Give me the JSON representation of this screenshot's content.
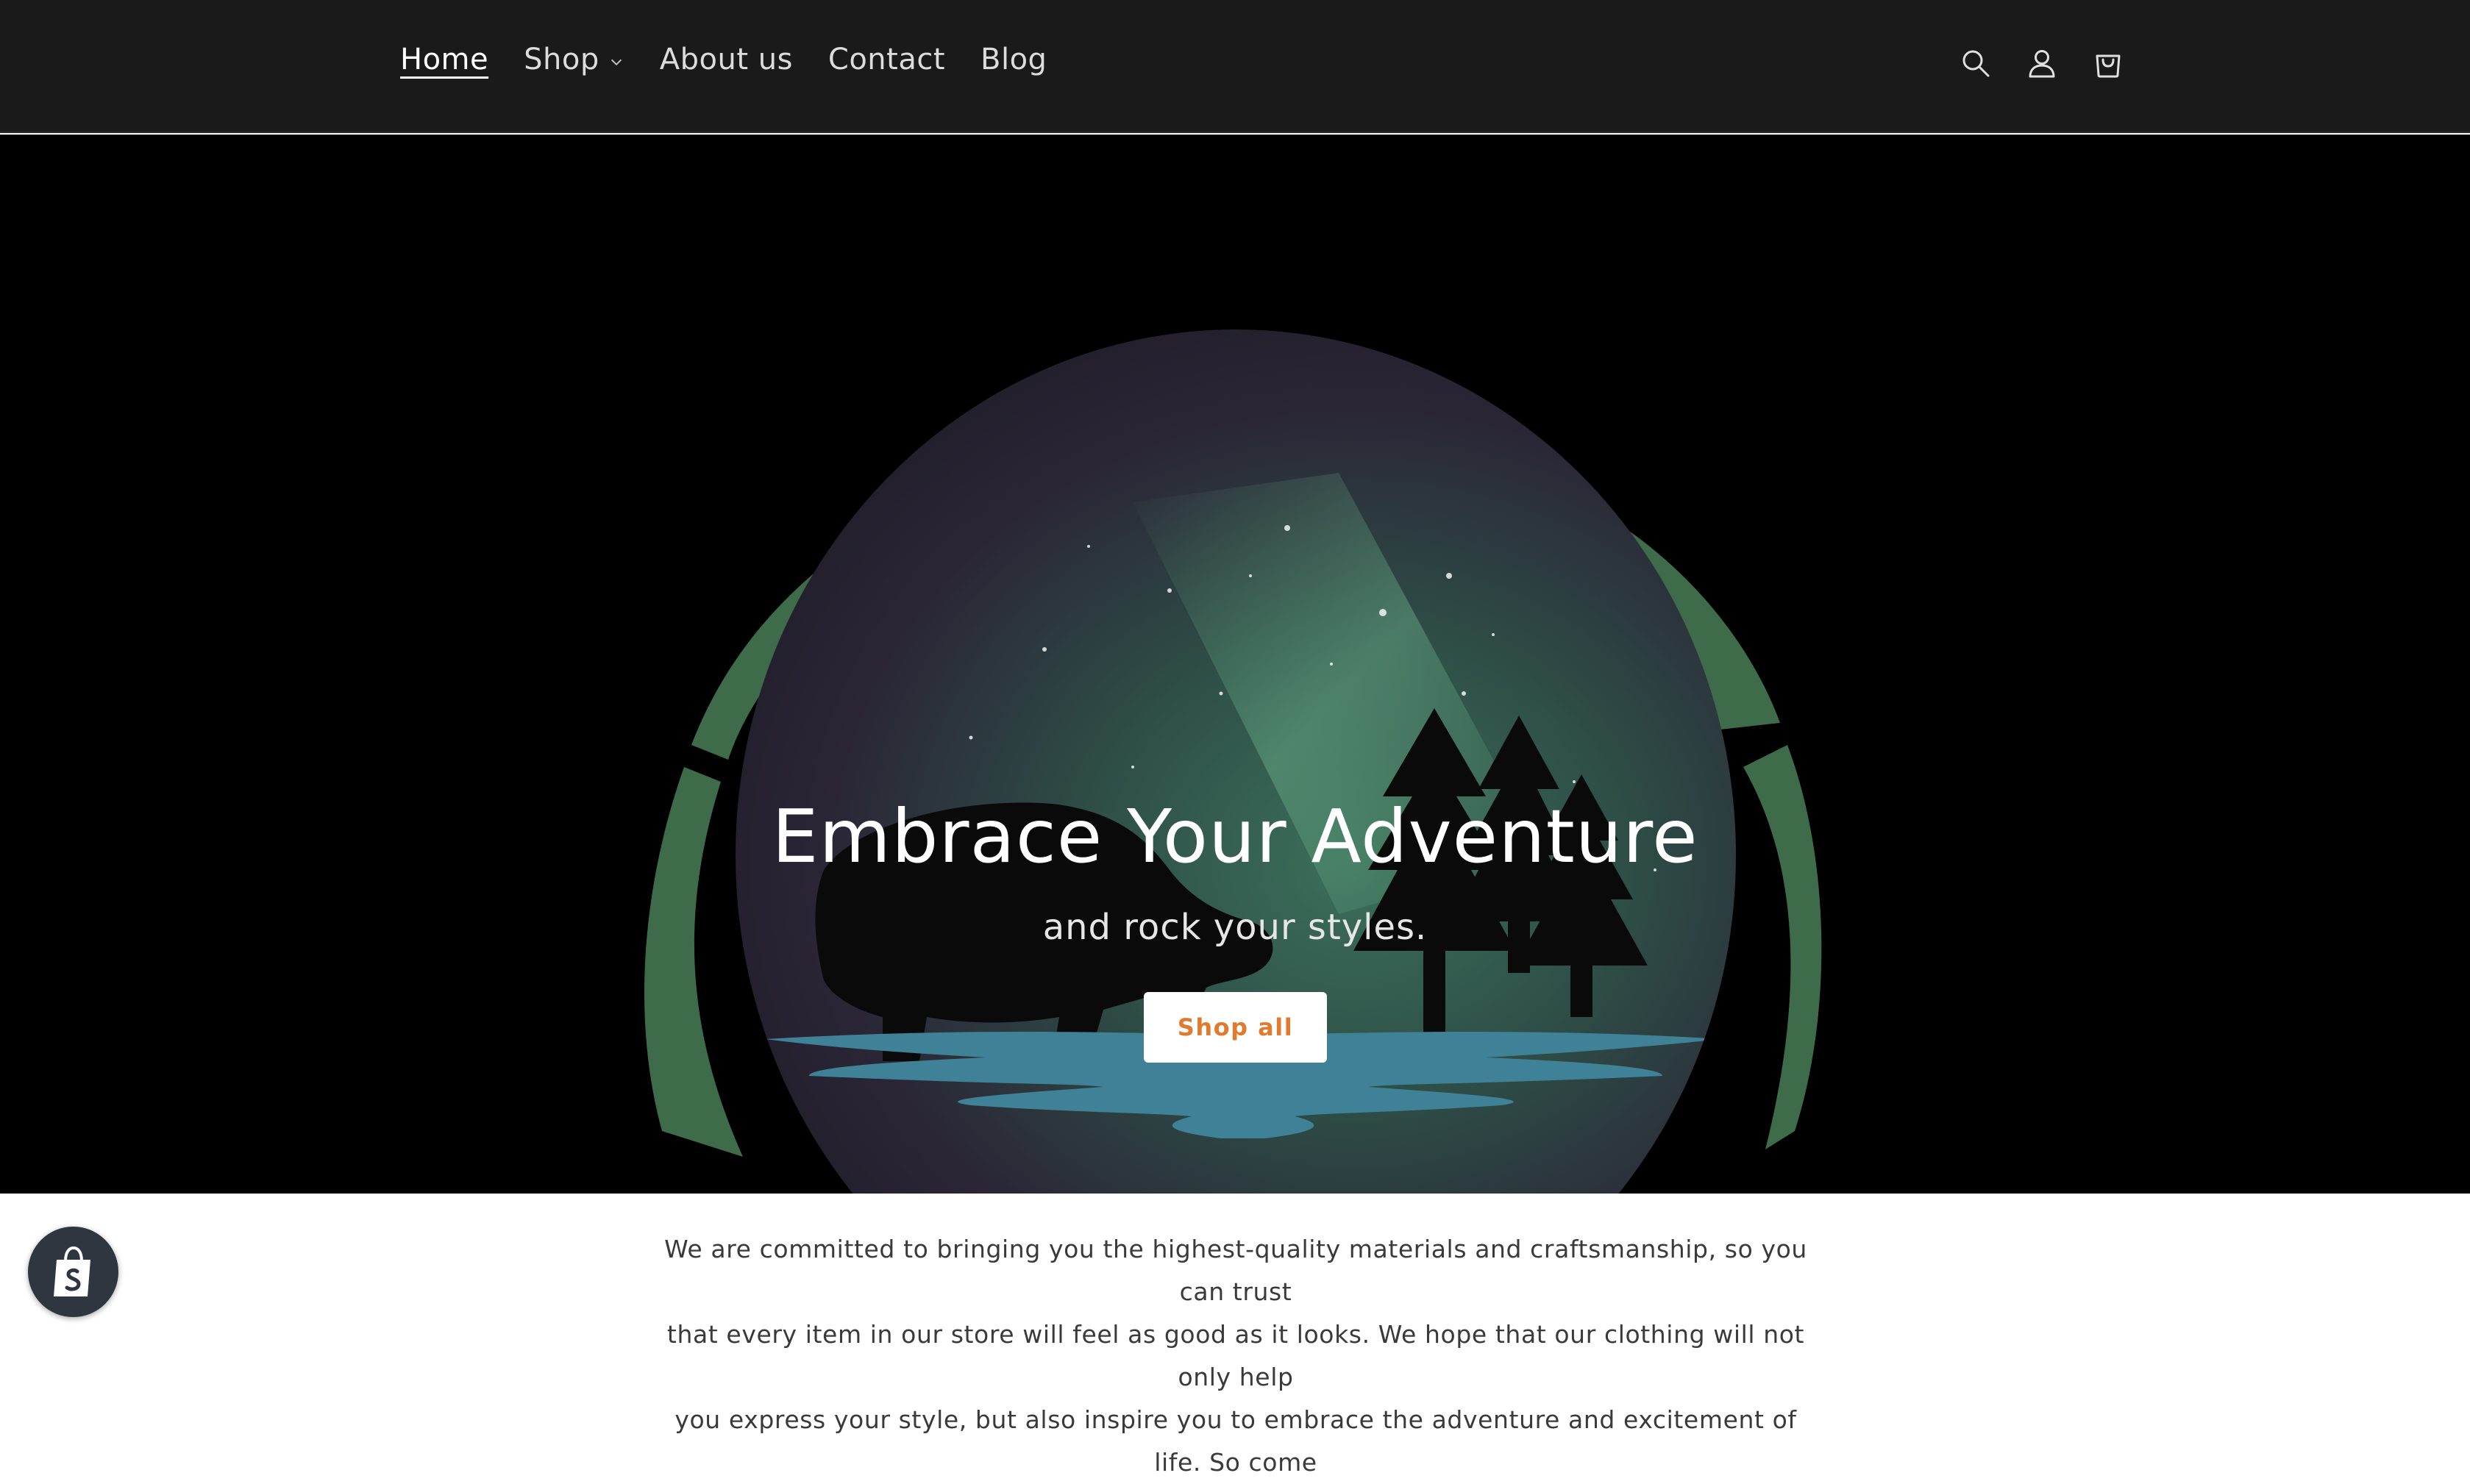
{
  "nav": {
    "items": [
      {
        "label": "Home",
        "active": true
      },
      {
        "label": "Shop",
        "has_dropdown": true
      },
      {
        "label": "About us"
      },
      {
        "label": "Contact"
      },
      {
        "label": "Blog"
      }
    ]
  },
  "header_icons": [
    "search-icon",
    "account-icon",
    "cart-icon"
  ],
  "hero": {
    "title": "Embrace Your Adventure",
    "subtitle": "and rock your styles.",
    "button_label": "Shop all"
  },
  "intro": {
    "lines": [
      "We are committed to bringing you the highest-quality materials and craftsmanship, so you can trust",
      "that every item in our store will feel as good as it looks. We hope that our clothing will not only help",
      "you express your style, but also inspire you to embrace the adventure and excitement of life. So come"
    ]
  },
  "colors": {
    "header_bg": "#1a1a1a",
    "hero_bg": "#000000",
    "ring_green": "#3e6b4a",
    "water_blue": "#3f8196",
    "button_text": "#e07a2e"
  },
  "badge": {
    "icon": "shopify-bag-icon"
  }
}
